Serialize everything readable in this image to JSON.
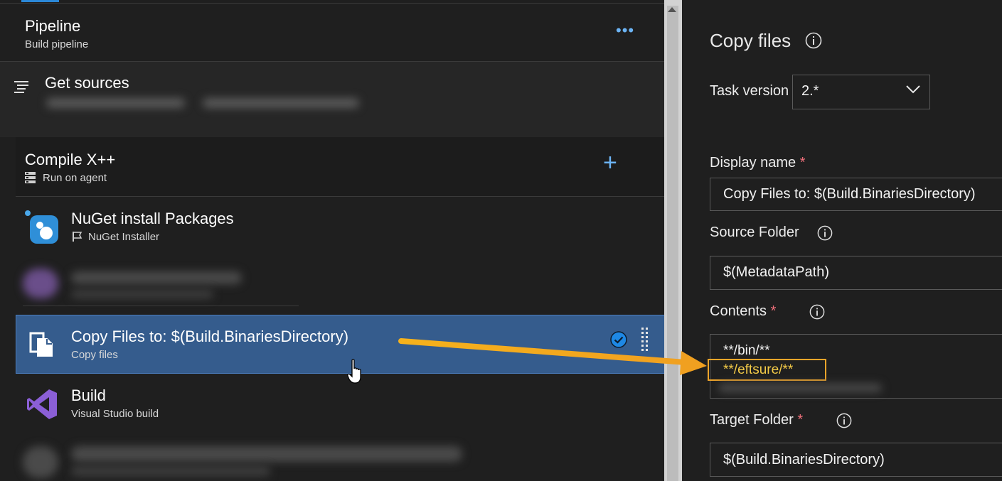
{
  "pipeline": {
    "title": "Pipeline",
    "subtitle": "Build pipeline",
    "more": "•••"
  },
  "sources": {
    "title": "Get sources"
  },
  "phase": {
    "title": "Compile X++",
    "subtitle": "Run on agent",
    "add": "+"
  },
  "tasks": [
    {
      "title": "NuGet install Packages",
      "subtitle": "NuGet Installer"
    },
    {
      "title": "Copy Files to: $(Build.BinariesDirectory)",
      "subtitle": "Copy files",
      "selected": true
    },
    {
      "title": "Build",
      "subtitle": "Visual Studio build"
    }
  ],
  "panel": {
    "title": "Copy files",
    "task_version_label": "Task version",
    "task_version_value": "2.*",
    "display_name_label": "Display name",
    "display_name_value": "Copy Files to: $(Build.BinariesDirectory)",
    "source_folder_label": "Source Folder",
    "source_folder_value": "$(MetadataPath)",
    "contents_label": "Contents",
    "contents_line1": "**/bin/**",
    "contents_line2": "**/eftsure/**",
    "target_folder_label": "Target Folder",
    "target_folder_value": "$(Build.BinariesDirectory)",
    "required_mark": "*"
  },
  "colors": {
    "accent": "#6cb4f5",
    "selected": "#355c8d",
    "highlight": "#f0a52a",
    "required": "#f1707b"
  }
}
